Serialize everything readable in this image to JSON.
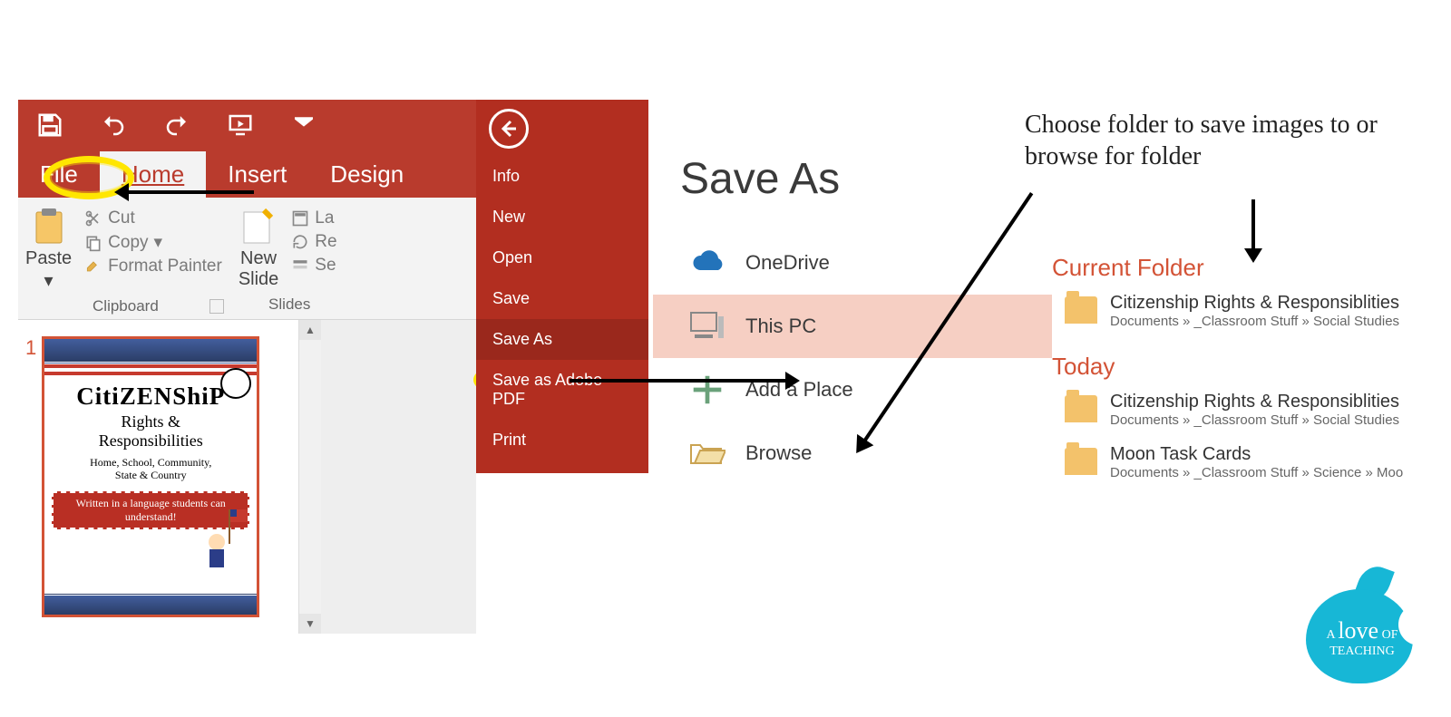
{
  "tabs": {
    "file": "File",
    "home": "Home",
    "insert": "Insert",
    "design": "Design"
  },
  "clipboard": {
    "paste": "Paste",
    "cut": "Cut",
    "copy": "Copy",
    "format_painter": "Format Painter",
    "group_label": "Clipboard"
  },
  "slides": {
    "new_slide": "New\nSlide",
    "layout_trunc": "La",
    "reset_trunc": "Re",
    "section_trunc": "Se",
    "group_label": "Slides"
  },
  "thumb": {
    "num": "1",
    "title": "CitiZENShiP",
    "subtitle": "Rights &\nResponsibilities",
    "line2": "Home, School, Community,\nState & Country",
    "redband": "Written in a language students can understand!"
  },
  "backstage": {
    "items": [
      "Info",
      "New",
      "Open",
      "Save",
      "Save As",
      "Save as Adobe PDF",
      "Print"
    ],
    "selected_index": 4
  },
  "saveas": {
    "heading": "Save As",
    "locations": [
      {
        "label": "OneDrive",
        "icon": "cloud"
      },
      {
        "label": "This PC",
        "icon": "pc",
        "selected": true
      },
      {
        "label": "Add a Place",
        "icon": "plus"
      },
      {
        "label": "Browse",
        "icon": "folder"
      }
    ]
  },
  "annotation": "Choose folder to save images to or browse for folder",
  "folders": {
    "section1_title": "Current Folder",
    "section2_title": "Today",
    "items1": [
      {
        "name": "Citizenship Rights & Responsiblities",
        "path": "Documents » _Classroom Stuff » Social Studies"
      }
    ],
    "items2": [
      {
        "name": "Citizenship Rights & Responsiblities",
        "path": "Documents » _Classroom Stuff » Social Studies"
      },
      {
        "name": "Moon Task Cards",
        "path": "Documents » _Classroom Stuff » Science » Moo"
      }
    ]
  },
  "logo": {
    "line1": "A",
    "love": "love",
    "of": "OF",
    "teaching": "TEACHING"
  },
  "colors": {
    "brand": "#b93b2d",
    "accent": "#d35336",
    "highlight": "#ffe600",
    "logo": "#17b7d6"
  }
}
